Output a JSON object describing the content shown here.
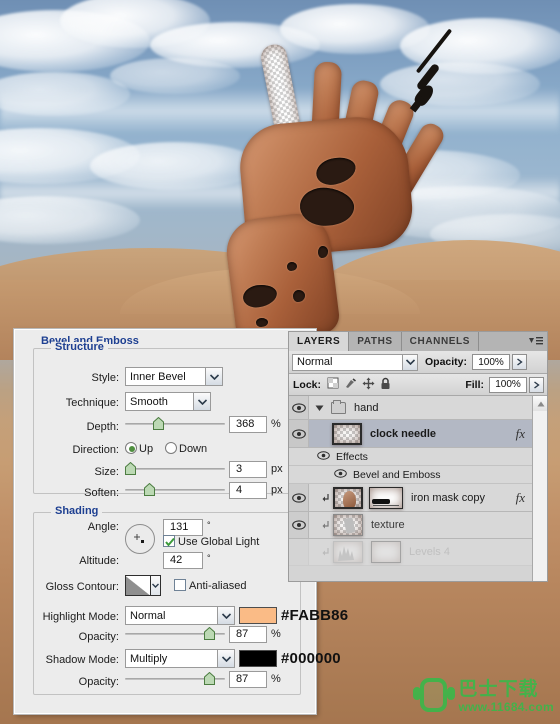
{
  "photo": {
    "description": "Desert sky with clouds and a rusted textured hand reaching upward holding a clock needle",
    "sky_color": "#8fb0cd",
    "sand_color": "#c4a07a",
    "hand_color": "#a9603a"
  },
  "dialog": {
    "title": "Bevel and Emboss",
    "structure": {
      "title": "Structure",
      "style_label": "Style:",
      "style_value": "Inner Bevel",
      "technique_label": "Technique:",
      "technique_value": "Smooth",
      "depth_label": "Depth:",
      "depth_value": "368",
      "depth_unit": "%",
      "depth_pct": 33,
      "direction_label": "Direction:",
      "direction_up": "Up",
      "direction_down": "Down",
      "direction_selected": "Up",
      "size_label": "Size:",
      "size_value": "3",
      "size_unit": "px",
      "size_pct": 2,
      "soften_label": "Soften:",
      "soften_value": "4",
      "soften_unit": "px",
      "soften_pct": 22
    },
    "shading": {
      "title": "Shading",
      "angle_label": "Angle:",
      "angle_value": "131",
      "angle_unit": "°",
      "use_global_light": "Use Global Light",
      "use_global_light_checked": true,
      "altitude_label": "Altitude:",
      "altitude_value": "42",
      "altitude_unit": "°",
      "gloss_contour_label": "Gloss Contour:",
      "anti_aliased_label": "Anti-aliased",
      "anti_aliased_checked": false,
      "highlight_mode_label": "Highlight Mode:",
      "highlight_mode_value": "Normal",
      "highlight_color": "#FABB86",
      "highlight_color_hex": "#FABB86",
      "highlight_opacity_label": "Opacity:",
      "highlight_opacity_value": "87",
      "highlight_opacity_unit": "%",
      "highlight_opacity_pct": 72,
      "shadow_mode_label": "Shadow Mode:",
      "shadow_mode_value": "Multiply",
      "shadow_color": "#000000",
      "shadow_color_hex": "#000000",
      "shadow_opacity_label": "Opacity:",
      "shadow_opacity_value": "87",
      "shadow_opacity_unit": "%",
      "shadow_opacity_pct": 72
    }
  },
  "layers_panel": {
    "tabs": [
      {
        "label": "LAYERS",
        "active": true
      },
      {
        "label": "PATHS",
        "active": false
      },
      {
        "label": "CHANNELS",
        "active": false
      }
    ],
    "blend_mode": "Normal",
    "opacity_label": "Opacity:",
    "opacity_value": "100%",
    "lock_label": "Lock:",
    "fill_label": "Fill:",
    "fill_value": "100%",
    "lock_icons": [
      "lock-transparent-pixels-icon",
      "lock-image-pixels-icon",
      "lock-position-icon",
      "lock-all-icon"
    ],
    "layers": [
      {
        "name": "hand",
        "type": "group",
        "visible": true,
        "selected": false,
        "fx": false
      },
      {
        "name": "clock needle",
        "type": "layer",
        "visible": true,
        "selected": true,
        "fx": true
      },
      {
        "name": "Effects",
        "type": "effects-header",
        "visible": true
      },
      {
        "name": "Bevel and Emboss",
        "type": "effect",
        "visible": true
      },
      {
        "name": "iron mask copy",
        "type": "layer",
        "visible": true,
        "selected": false,
        "fx": true,
        "clipped": true,
        "has_mask": true
      },
      {
        "name": "texture",
        "type": "layer",
        "visible": true,
        "selected": false,
        "fx": false,
        "clipped": true
      },
      {
        "name": "Levels 4",
        "type": "adjustment",
        "visible": false,
        "selected": false,
        "clipped": true,
        "dimmed": true
      }
    ]
  },
  "watermark": {
    "cn_text": "巴士下载",
    "url": "www.11684.com",
    "color": "#3fb54a"
  }
}
